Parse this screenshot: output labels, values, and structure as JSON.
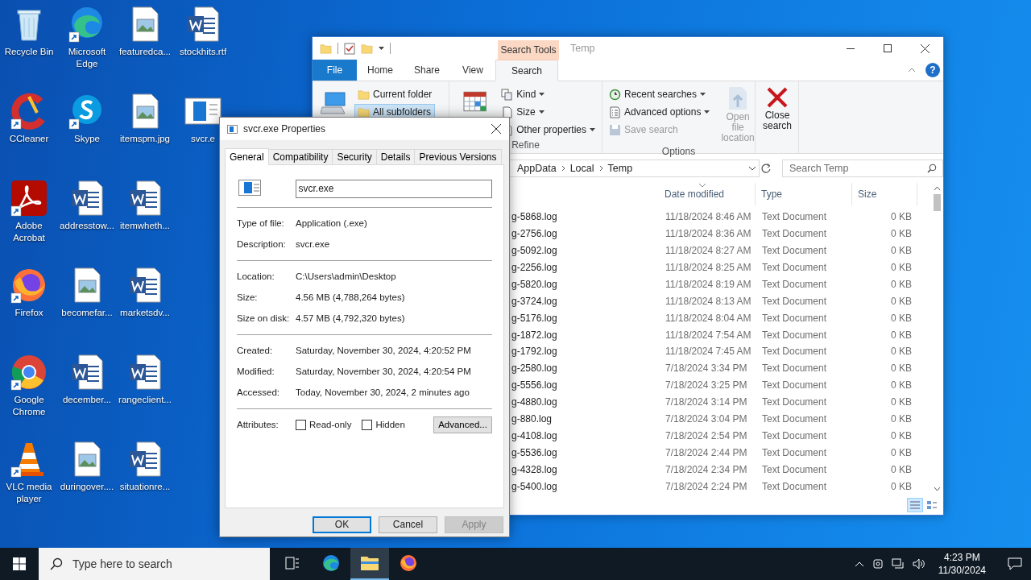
{
  "desktop": {
    "icons": [
      {
        "label": "Recycle Bin",
        "kind": "recycle"
      },
      {
        "label": "CCleaner",
        "kind": "ccleaner"
      },
      {
        "label": "Adobe Acrobat",
        "kind": "acrobat"
      },
      {
        "label": "Firefox",
        "kind": "firefox"
      },
      {
        "label": "Google Chrome",
        "kind": "chrome"
      },
      {
        "label": "VLC media player",
        "kind": "vlc"
      },
      {
        "label": "Microsoft Edge",
        "kind": "edge"
      },
      {
        "label": "Skype",
        "kind": "skype"
      },
      {
        "label": "addresstow...",
        "kind": "word"
      },
      {
        "label": "becomefar...",
        "kind": "image"
      },
      {
        "label": "december...",
        "kind": "word"
      },
      {
        "label": "duringover....",
        "kind": "image"
      },
      {
        "label": "featuredca...",
        "kind": "image"
      },
      {
        "label": "itemspm.jpg",
        "kind": "image"
      },
      {
        "label": "itemwheth...",
        "kind": "word"
      },
      {
        "label": "marketsdv...",
        "kind": "word"
      },
      {
        "label": "rangeclient...",
        "kind": "word"
      },
      {
        "label": "situationre...",
        "kind": "word"
      },
      {
        "label": "stockhits.rtf",
        "kind": "word"
      },
      {
        "label": "svcr.e",
        "kind": "exe"
      }
    ]
  },
  "explorer": {
    "contextual_tab": "Search Tools",
    "title": "Temp",
    "help": "?",
    "tabs": [
      {
        "label": "File",
        "kind": "file",
        "selected": false
      },
      {
        "label": "Home",
        "kind": "tab",
        "selected": false
      },
      {
        "label": "Share",
        "kind": "tab",
        "selected": false
      },
      {
        "label": "View",
        "kind": "tab",
        "selected": false
      },
      {
        "label": "Search",
        "kind": "tab",
        "selected": true
      }
    ],
    "location": [
      {
        "label": "Current folder",
        "selected": false
      },
      {
        "label": "All subfolders",
        "selected": true
      }
    ],
    "refine": {
      "items": [
        "Kind",
        "Size",
        "Other properties"
      ],
      "label": "Refine"
    },
    "options": {
      "items": [
        {
          "label": "Recent searches",
          "kind": "recent",
          "disabled": false
        },
        {
          "label": "Advanced options",
          "kind": "advanced",
          "disabled": false
        },
        {
          "label": "Save search",
          "kind": "save",
          "disabled": true
        }
      ],
      "open_file_location": {
        "label": "Open file location",
        "disabled": true
      },
      "label": "Options"
    },
    "close_search": "Close search",
    "address": [
      "AppData",
      "Local",
      "Temp"
    ],
    "search": {
      "placeholder": "Search Temp"
    },
    "columns": [
      "Date modified",
      "Type",
      "Size"
    ],
    "rows": [
      {
        "name": "g-5868.log",
        "date": "11/18/2024 8:46 AM",
        "type": "Text Document",
        "size": "0 KB"
      },
      {
        "name": "g-2756.log",
        "date": "11/18/2024 8:36 AM",
        "type": "Text Document",
        "size": "0 KB"
      },
      {
        "name": "g-5092.log",
        "date": "11/18/2024 8:27 AM",
        "type": "Text Document",
        "size": "0 KB"
      },
      {
        "name": "g-2256.log",
        "date": "11/18/2024 8:25 AM",
        "type": "Text Document",
        "size": "0 KB"
      },
      {
        "name": "g-5820.log",
        "date": "11/18/2024 8:19 AM",
        "type": "Text Document",
        "size": "0 KB"
      },
      {
        "name": "g-3724.log",
        "date": "11/18/2024 8:13 AM",
        "type": "Text Document",
        "size": "0 KB"
      },
      {
        "name": "g-5176.log",
        "date": "11/18/2024 8:04 AM",
        "type": "Text Document",
        "size": "0 KB"
      },
      {
        "name": "g-1872.log",
        "date": "11/18/2024 7:54 AM",
        "type": "Text Document",
        "size": "0 KB"
      },
      {
        "name": "g-1792.log",
        "date": "11/18/2024 7:45 AM",
        "type": "Text Document",
        "size": "0 KB"
      },
      {
        "name": "g-2580.log",
        "date": "7/18/2024 3:34 PM",
        "type": "Text Document",
        "size": "0 KB"
      },
      {
        "name": "g-5556.log",
        "date": "7/18/2024 3:25 PM",
        "type": "Text Document",
        "size": "0 KB"
      },
      {
        "name": "g-4880.log",
        "date": "7/18/2024 3:14 PM",
        "type": "Text Document",
        "size": "0 KB"
      },
      {
        "name": "g-880.log",
        "date": "7/18/2024 3:04 PM",
        "type": "Text Document",
        "size": "0 KB"
      },
      {
        "name": "g-4108.log",
        "date": "7/18/2024 2:54 PM",
        "type": "Text Document",
        "size": "0 KB"
      },
      {
        "name": "g-5536.log",
        "date": "7/18/2024 2:44 PM",
        "type": "Text Document",
        "size": "0 KB"
      },
      {
        "name": "g-4328.log",
        "date": "7/18/2024 2:34 PM",
        "type": "Text Document",
        "size": "0 KB"
      },
      {
        "name": "g-5400.log",
        "date": "7/18/2024 2:24 PM",
        "type": "Text Document",
        "size": "0 KB"
      }
    ],
    "views": [
      {
        "kind": "details",
        "selected": true
      },
      {
        "kind": "tiles",
        "selected": false
      }
    ]
  },
  "properties": {
    "title": "svcr.exe Properties",
    "tabs": [
      {
        "label": "General",
        "selected": true
      },
      {
        "label": "Compatibility",
        "selected": false
      },
      {
        "label": "Security",
        "selected": false
      },
      {
        "label": "Details",
        "selected": false
      },
      {
        "label": "Previous Versions",
        "selected": false
      }
    ],
    "file_name": "svcr.exe",
    "groups": [
      [
        {
          "label": "Type of file:",
          "value": "Application (.exe)"
        },
        {
          "label": "Description:",
          "value": "svcr.exe"
        }
      ],
      [
        {
          "label": "Location:",
          "value": "C:\\Users\\admin\\Desktop"
        },
        {
          "label": "Size:",
          "value": "4.56 MB (4,788,264 bytes)"
        },
        {
          "label": "Size on disk:",
          "value": "4.57 MB (4,792,320 bytes)"
        }
      ],
      [
        {
          "label": "Created:",
          "value": "Saturday, November 30, 2024, 4:20:52 PM"
        },
        {
          "label": "Modified:",
          "value": "Saturday, November 30, 2024, 4:20:54 PM"
        },
        {
          "label": "Accessed:",
          "value": "Today, November 30, 2024, 2 minutes ago"
        }
      ]
    ],
    "attributes": {
      "label": "Attributes:",
      "options": [
        {
          "label": "Read-only",
          "checked": false
        },
        {
          "label": "Hidden",
          "checked": false
        }
      ],
      "advanced": "Advanced..."
    },
    "buttons": [
      {
        "label": "OK",
        "default": true,
        "disabled": false
      },
      {
        "label": "Cancel",
        "default": false,
        "disabled": false
      },
      {
        "label": "Apply",
        "default": false,
        "disabled": true
      }
    ]
  },
  "taskbar": {
    "search_placeholder": "Type here to search",
    "apps": [
      {
        "kind": "taskview",
        "active": false
      },
      {
        "kind": "edge",
        "active": false
      },
      {
        "kind": "explorer",
        "active": true
      },
      {
        "kind": "firefox",
        "active": false
      }
    ],
    "time": "4:23 PM",
    "date": "11/30/2024"
  }
}
